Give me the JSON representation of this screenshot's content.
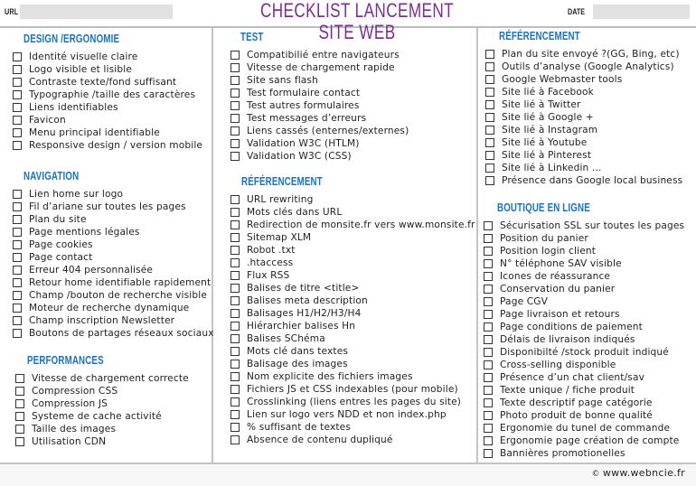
{
  "header": {
    "url_label": "URL",
    "url_value": "",
    "title": "CHECKLIST LANCEMENT SITE WEB",
    "date_label": "DATE",
    "date_value": ""
  },
  "columns": [
    {
      "sections": [
        {
          "title": "DESIGN /ERGONOMIE",
          "items": [
            "Identité visuelle claire",
            "Logo visible et lisible",
            "Contraste texte/fond suffisant",
            "Typographie /taille des caractères",
            "Liens identifiables",
            "Favicon",
            "Menu principal identifiable",
            "Responsive design / version mobile"
          ]
        },
        {
          "title": "NAVIGATION",
          "items": [
            "Lien home sur logo",
            "Fil d’ariane sur toutes les pages",
            "Plan du site",
            "Page mentions légales",
            "Page cookies",
            "Page contact",
            "Erreur 404 personnalisée",
            "Retour home identifiable rapidement",
            "Champ /bouton de recherche visible",
            "Moteur de recherche dynamique",
            "Champ inscription Newsletter",
            "Boutons de partages réseaux sociaux"
          ]
        },
        {
          "title": "PERFORMANCES",
          "items": [
            "Vitesse de chargement correcte",
            "Compression CSS",
            "Compression JS",
            "Systeme de cache activité",
            "Taille des images",
            "Utilisation CDN"
          ]
        }
      ]
    },
    {
      "sections": [
        {
          "title": "TEST",
          "items": [
            "Compatibilié entre navigateurs",
            "Vitesse de chargement rapide",
            "Site sans flash",
            "Test formulaire contact",
            "Test autres formulaires",
            "Test messages d’erreurs",
            "Liens cassés (enternes/externes)",
            "Validation W3C (HTLM)",
            "Validation W3C (CSS)"
          ]
        },
        {
          "title": "RÉFÉRENCEMENT",
          "items": [
            "URL rewriting",
            "Mots clés dans URL",
            "Redirection de monsite.fr vers www.monsite.fr",
            "Sitemap XLM",
            "Robot .txt",
            ".htaccess",
            "Flux RSS",
            "Balises de titre <title>",
            "Balises meta description",
            "Balisages H1/H2/H3/H4",
            "Hiérarchier balises Hn",
            "Balises SChéma",
            "Mots clé dans textes",
            "Balisage des images",
            "Nom explicite des fichiers images",
            "Fichiers JS et CSS indexables  (pour mobile)",
            "Crosslinking (liens entres les pages du site)",
            "Lien sur logo vers NDD et non index.php",
            "% suffisant de textes",
            "Absence de contenu dupliqué"
          ]
        }
      ]
    },
    {
      "sections": [
        {
          "title": "RÉFÉRENCEMENT",
          "items": [
            "Plan du site envoyé ?(GG, Bing, etc)",
            "Outils d’analyse (Google Analytics)",
            "Google Webmaster tools",
            "Site lié à Facebook",
            "Site lié à Twitter",
            "Site lié à Google +",
            "Site lié à Instagram",
            "Site lié à Youtube",
            "Site lié à Pinterest",
            "Site lié à Linkedin ...",
            "Présence dans  Google local business"
          ]
        },
        {
          "title": "BOUTIQUE EN LIGNE",
          "items": [
            "Sécurisation SSL sur toutes les pages",
            "Position du panier",
            "Position login client",
            "N° téléphone SAV visible",
            "Icones de réassurance",
            "Conservation du panier",
            "Page CGV",
            "Page livraison et retours",
            "Page conditions de paiement",
            "Délais de livraison indiqués",
            "Disponibilté /stock produit indiqué",
            "Cross-selling disponible",
            "Présence d’un chat client/sav",
            "Texte unique / fiche produit",
            "Texte descriptif page catégorie",
            "Photo produit de bonne qualité",
            "Ergonomie du tunel de commande",
            "Ergonomie page création de compte",
            "Bannières promotionelles"
          ]
        }
      ]
    }
  ],
  "footer": {
    "copyright_symbol": "©",
    "credit": "www.webncie.fr"
  },
  "colors": {
    "title": "#7b2f8e",
    "section_title": "#1a73bb",
    "field_bg": "#e1e1e1",
    "divider": "#c4c4c4"
  }
}
